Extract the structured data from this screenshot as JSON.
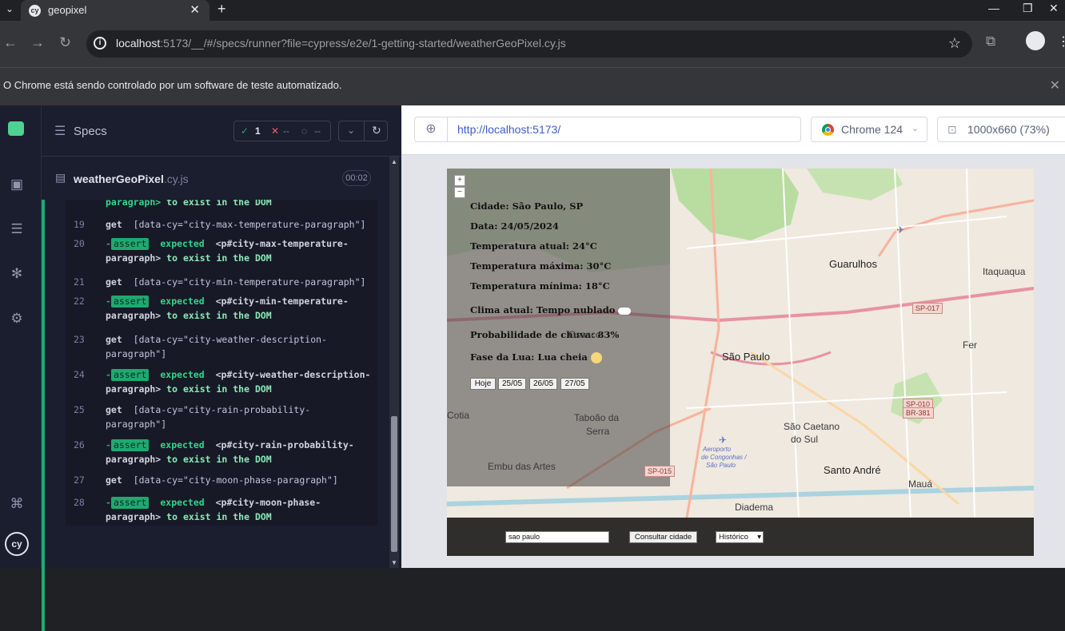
{
  "browser": {
    "tab_title": "geopixel",
    "url_host": "localhost",
    "url_path": ":5173/__/#/specs/runner?file=cypress/e2e/1-getting-started/weatherGeoPixel.cy.js",
    "infobar_message": "O Chrome está sendo controlado por um software de teste automatizado."
  },
  "reporter": {
    "specs_label": "Specs",
    "passed": "1",
    "failed": "--",
    "pending": "--",
    "spec_name": "weatherGeoPixel",
    "spec_ext": ".cy.js",
    "duration": "00:02",
    "commands": [
      {
        "type": "tail",
        "text": "paragraph>",
        "tail": " to exist in the DOM"
      },
      {
        "type": "get",
        "num": "19",
        "selector": "[data-cy=\"city-max-temperature-paragraph\"]"
      },
      {
        "type": "assert",
        "num": "20",
        "expected": "expected",
        "subject": "<p#city-max-temperature-",
        "subject2": "paragraph>",
        "tail": " to exist in the DOM"
      },
      {
        "type": "get",
        "num": "21",
        "selector": "[data-cy=\"city-min-temperature-paragraph\"]"
      },
      {
        "type": "assert",
        "num": "22",
        "expected": "expected",
        "subject": "<p#city-min-temperature-",
        "subject2": "paragraph>",
        "tail": " to exist in the DOM"
      },
      {
        "type": "get",
        "num": "23",
        "selector": "[data-cy=\"city-weather-description-",
        "selector2": "paragraph\"]"
      },
      {
        "type": "assert",
        "num": "24",
        "expected": "expected",
        "subject": "<p#city-weather-description-",
        "subject2": "paragraph>",
        "tail": " to exist in the DOM"
      },
      {
        "type": "get",
        "num": "25",
        "selector": "[data-cy=\"city-rain-probability-",
        "selector2": "paragraph\"]"
      },
      {
        "type": "assert",
        "num": "26",
        "expected": "expected",
        "subject": "<p#city-rain-probability-",
        "subject2": "paragraph>",
        "tail": " to exist in the DOM"
      },
      {
        "type": "get",
        "num": "27",
        "selector": "[data-cy=\"city-moon-phase-paragraph\"]"
      },
      {
        "type": "assert",
        "num": "28",
        "expected": "expected",
        "subject": "<p#city-moon-phase-",
        "subject2": "paragraph>",
        "tail": " to exist in the DOM"
      }
    ],
    "get_label": "get",
    "assert_label": "assert"
  },
  "aut": {
    "url": "http://localhost:5173/",
    "browser_label": "Chrome 124",
    "viewport_label": "1000x660 (73%)"
  },
  "app": {
    "weather_lines": [
      "Cidade: São Paulo, SP",
      "Data: 24/05/2024",
      "Temperatura atual: 24°C",
      "Temperatura máxima: 30°C",
      "Temperatura mínima: 18°C",
      "Clima atual: Tempo nublado",
      "Probabilidade de chuva: 83%",
      "Fase da Lua: Lua cheia"
    ],
    "day_buttons": [
      "Hoje",
      "25/05",
      "26/05",
      "27/05"
    ],
    "city_input_value": "sao paulo",
    "consult_button": "Consultar cidade",
    "history_select": "Histórico",
    "zoom_in": "+",
    "zoom_out": "−",
    "map_labels": {
      "sao_paulo": "São Paulo",
      "guarulhos": "Guarulhos",
      "itaquaqua": "Itaquaqua",
      "sao_caetano": "São Caetano",
      "do_sul": "do Sul",
      "santo_andre": "Santo André",
      "maua": "Mauá",
      "diadema": "Diadema",
      "taboao": "Taboão da",
      "serra": "Serra",
      "embu": "Embu das Artes",
      "cotia": "Cotia",
      "osasco": "Osasco",
      "fer": "Fer",
      "aeroporto": "Aeroporto",
      "congonhas": "de Congonhas /",
      "sp_campo": "São Paulo"
    },
    "shields": [
      "SP-017",
      "SP-010",
      "BR-381",
      "SP-015"
    ]
  }
}
